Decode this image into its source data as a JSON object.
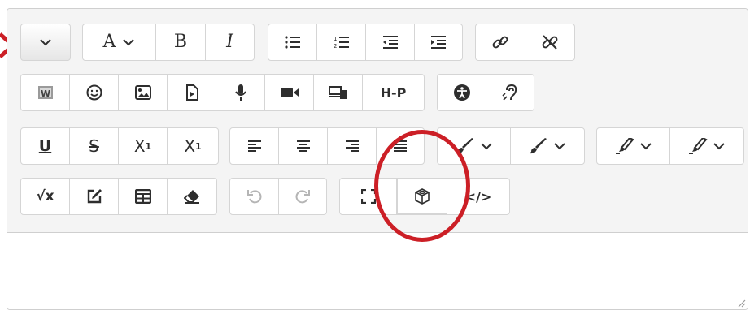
{
  "toolbar": {
    "row1": {
      "expand": {
        "icon": "chevron-down-icon"
      },
      "font": {
        "label": "A",
        "icon": "chevron-down-icon"
      },
      "bold": {
        "label": "B"
      },
      "italic": {
        "label": "I"
      },
      "lists": [
        "bullet-list-icon",
        "numbered-list-icon",
        "outdent-icon",
        "indent-icon"
      ],
      "links": [
        "link-icon",
        "unlink-icon"
      ]
    },
    "row2": {
      "media": [
        "word-paste-icon",
        "emoji-icon",
        "image-icon",
        "media-file-icon",
        "microphone-icon",
        "video-camera-icon",
        "manage-files-icon"
      ],
      "h5p_label": "H-P",
      "accessibility": [
        "accessibility-icon",
        "screen-reader-icon"
      ]
    },
    "row3": {
      "underline_label": "U",
      "strike_label": "S",
      "subscript": {
        "base": "X",
        "index": "1"
      },
      "superscript": {
        "base": "X",
        "index": "1"
      },
      "align": [
        "align-left-icon",
        "align-center-icon",
        "align-right-icon",
        "align-justify-icon"
      ],
      "colors": [
        "text-color-icon",
        "background-color-icon"
      ],
      "highlight": [
        "highlight-icon",
        "highlight-color-icon"
      ]
    },
    "row4": {
      "math_label": "√x",
      "tools": [
        "edit-note-icon",
        "table-icon",
        "eraser-icon"
      ],
      "history": [
        "undo-icon",
        "redo-icon"
      ],
      "fullscreen": "fullscreen-icon",
      "content_bank": "cube-icon",
      "html_label": "</>"
    }
  },
  "annotation_color": "#cc1f26"
}
